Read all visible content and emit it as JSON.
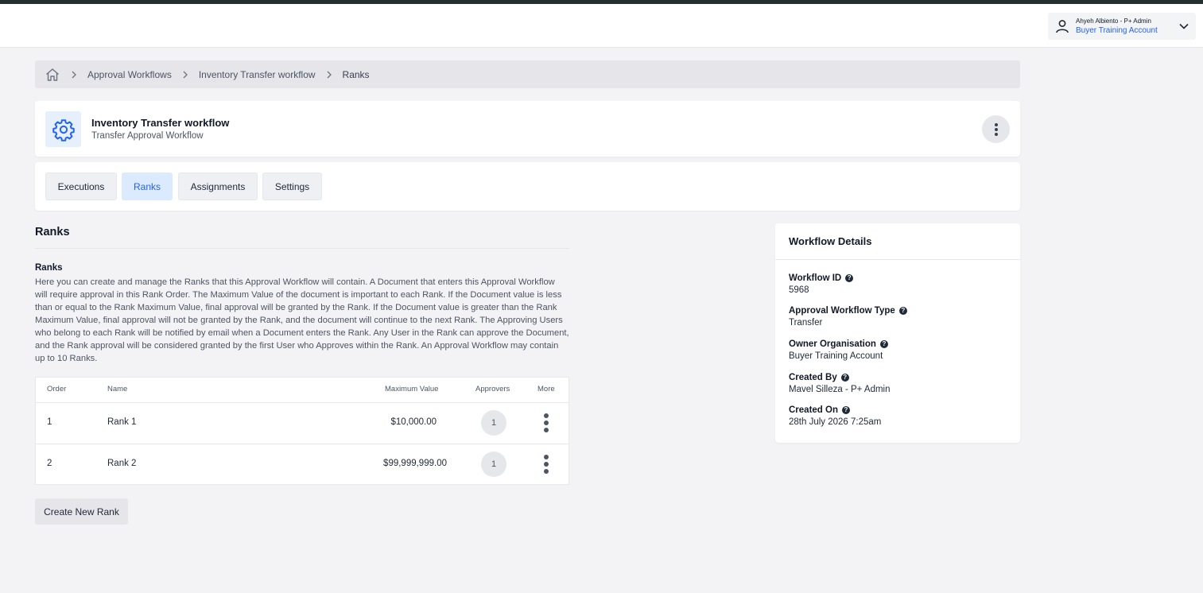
{
  "user_menu": {
    "name": "Ahyeh Albiento - P+ Admin",
    "organisation": "Buyer Training Account"
  },
  "breadcrumb": {
    "items": [
      "Approval Workflows",
      "Inventory Transfer workflow",
      "Ranks"
    ]
  },
  "workflow": {
    "title": "Inventory Transfer workflow",
    "subtitle": "Transfer Approval Workflow"
  },
  "tabs": [
    {
      "label": "Executions",
      "active": false
    },
    {
      "label": "Ranks",
      "active": true
    },
    {
      "label": "Assignments",
      "active": false
    },
    {
      "label": "Settings",
      "active": false
    }
  ],
  "ranks_section": {
    "title": "Ranks",
    "info_heading": "Ranks",
    "info_text": "Here you can create and manage the Ranks that this Approval Workflow will contain. A Document that enters this Approval Workflow will require approval in this Rank Order. The Maximum Value of the document is important to each Rank. If the Document value is less than or equal to the Rank Maximum Value, final approval will be granted by the Rank. If the Document value is greater than the Rank Maximum Value, final approval will not be granted by the Rank, and the document will continue to the next Rank. The Approving Users who belong to each Rank will be notified by email when a Document enters the Rank. Any User in the Rank can approve the Document, and the Rank approval will be considered granted by the first User who Approves within the Rank. An Approval Workflow may contain up to 10 Ranks."
  },
  "table": {
    "headers": {
      "order": "Order",
      "name": "Name",
      "max_value": "Maximum Value",
      "approvers": "Approvers",
      "more": "More"
    },
    "rows": [
      {
        "order": "1",
        "name": "Rank 1",
        "max_value": "$10,000.00",
        "approvers": "1"
      },
      {
        "order": "2",
        "name": "Rank 2",
        "max_value": "$99,999,999.00",
        "approvers": "1"
      }
    ]
  },
  "create_button_label": "Create New Rank",
  "details": {
    "title": "Workflow Details",
    "fields": [
      {
        "label": "Workflow ID",
        "value": "5968"
      },
      {
        "label": "Approval Workflow Type",
        "value": "Transfer"
      },
      {
        "label": "Owner Organisation",
        "value": "Buyer Training Account"
      },
      {
        "label": "Created By",
        "value": "Mavel Silleza - P+ Admin"
      },
      {
        "label": "Created On",
        "value": "28th July 2026 7:25am"
      }
    ]
  },
  "colors": {
    "accent": "#2563eb",
    "active_tab_bg": "#dbeafe",
    "top_strip": "#24302f"
  },
  "icons": {
    "user": "user-icon",
    "dropdown": "chevron-down-icon",
    "home": "home-icon",
    "separator": "chevron-right-icon",
    "workflow": "gear-icon",
    "more": "kebab-icon",
    "help": "question-circle-icon"
  }
}
